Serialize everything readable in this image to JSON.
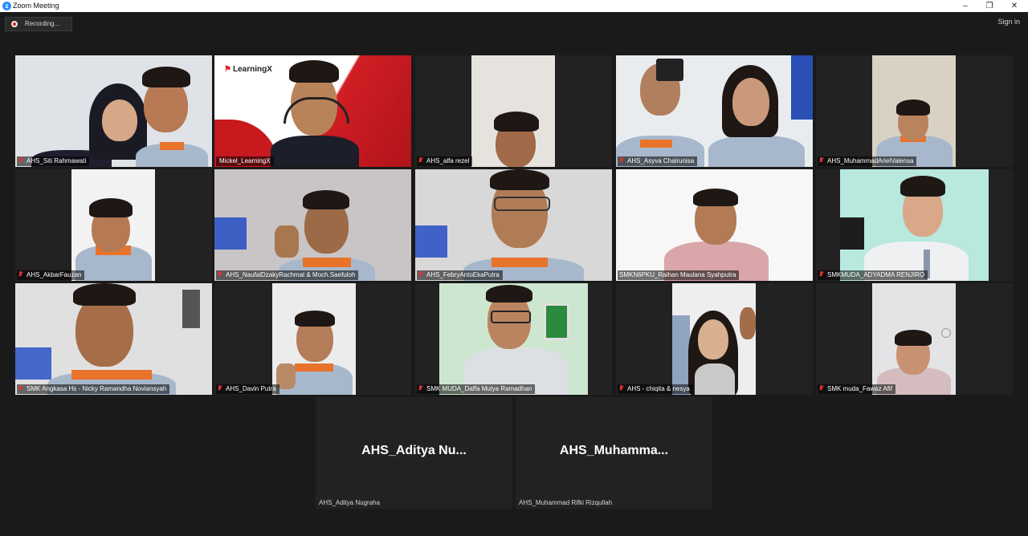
{
  "window": {
    "app_icon": "zoom-icon",
    "title": "Zoom Meeting",
    "controls": {
      "minimize": "–",
      "maximize": "❐",
      "close": "✕"
    }
  },
  "toolbar": {
    "recording_label": "Recording...",
    "signin_label": "Sign in"
  },
  "participants": [
    {
      "name": "AHS_Siti Rahmawati",
      "muted": true
    },
    {
      "name": "Mickel_LearningX",
      "muted": false,
      "active_speaker": true,
      "background_logo": "LearningX"
    },
    {
      "name": "AHS_alfa rezel",
      "muted": true
    },
    {
      "name": "AHS_Asyva Chairunisa",
      "muted": true
    },
    {
      "name": "AHS_MuhammadArielValensa",
      "muted": true
    },
    {
      "name": "AHS_AkbarFauzan",
      "muted": true
    },
    {
      "name": "AHS_NaufalDzakyRachmat & Moch.Saefuloh",
      "muted": true
    },
    {
      "name": "AHS_FebryAntoEkaPutra",
      "muted": true
    },
    {
      "name": "SMKN6PKU_Raihan Maulana Syahputra",
      "muted": false
    },
    {
      "name": "SMKMUDA_ADYADMA RENJIRO",
      "muted": true
    },
    {
      "name": "SMK Angkasa Hs - Nicky Ramandha Noviansyah",
      "muted": true
    },
    {
      "name": "AHS_Davin Putra",
      "muted": true
    },
    {
      "name": "SMK MUDA_Daffa Mulya Ramadhan",
      "muted": true
    },
    {
      "name": "AHS - chiqita & nesya",
      "muted": true
    },
    {
      "name": "SMK muda_Fawaz Afif",
      "muted": true
    },
    {
      "name": "AHS_Aditya Nugraha",
      "muted": false,
      "video_off": true,
      "display_name": "AHS_Aditya  Nu..."
    },
    {
      "name": "AHS_Muhammad Rifki Rizqullah",
      "muted": false,
      "video_off": true,
      "display_name": "AHS_Muhamma..."
    }
  ],
  "colors": {
    "background": "#1a1a1a",
    "active_speaker_border": "#d6e232",
    "muted_icon": "#e03232",
    "zoom_blue": "#2d8cff"
  }
}
